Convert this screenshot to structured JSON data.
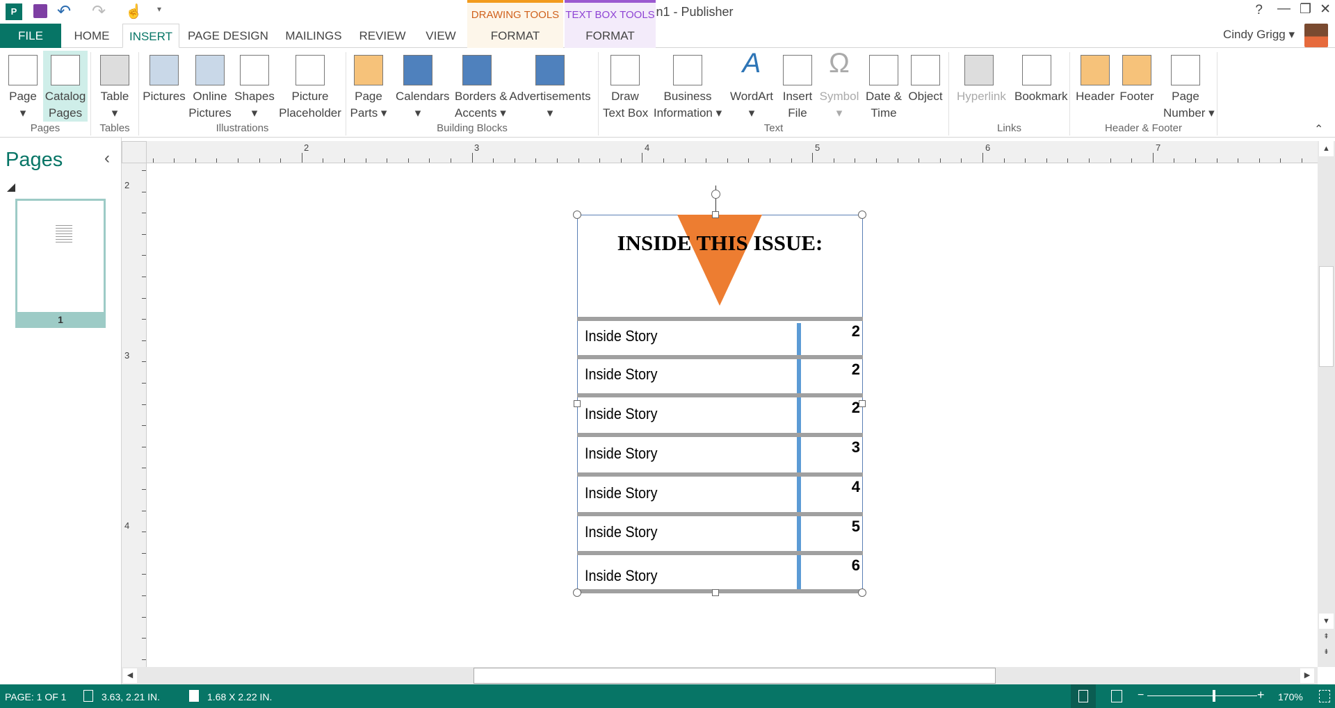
{
  "window": {
    "title": "Publication1 - Publisher",
    "user": "Cindy Grigg",
    "help": "?",
    "minimize": "—",
    "restore": "❐",
    "close": "✕"
  },
  "quick_access": {
    "icons": [
      "publisher-logo-icon",
      "save-icon",
      "undo-icon",
      "redo-icon",
      "touch-mode-icon",
      "customize-icon"
    ]
  },
  "contextual": [
    {
      "header": "DRAWING TOOLS",
      "tab": "FORMAT",
      "color": "#e36c09"
    },
    {
      "header": "TEXT BOX TOOLS",
      "tab": "FORMAT",
      "color": "#8e44d4"
    }
  ],
  "tabs": [
    "FILE",
    "HOME",
    "INSERT",
    "PAGE DESIGN",
    "MAILINGS",
    "REVIEW",
    "VIEW"
  ],
  "active_tab": "INSERT",
  "ribbon": {
    "groups": [
      "Pages",
      "Tables",
      "Illustrations",
      "Building Blocks",
      "Text",
      "Links",
      "Header & Footer"
    ],
    "buttons": [
      {
        "l1": "Page",
        "l2": "▾"
      },
      {
        "l1": "Catalog",
        "l2": "Pages"
      },
      {
        "l1": "Table",
        "l2": "▾"
      },
      {
        "l1": "Pictures",
        "l2": ""
      },
      {
        "l1": "Online",
        "l2": "Pictures"
      },
      {
        "l1": "Shapes",
        "l2": "▾"
      },
      {
        "l1": "Picture",
        "l2": "Placeholder"
      },
      {
        "l1": "Page",
        "l2": "Parts ▾"
      },
      {
        "l1": "Calendars",
        "l2": "▾"
      },
      {
        "l1": "Borders &",
        "l2": "Accents ▾"
      },
      {
        "l1": "Advertisements",
        "l2": "▾"
      },
      {
        "l1": "Draw",
        "l2": "Text Box"
      },
      {
        "l1": "Business",
        "l2": "Information ▾"
      },
      {
        "l1": "WordArt",
        "l2": "▾"
      },
      {
        "l1": "Insert",
        "l2": "File"
      },
      {
        "l1": "Symbol",
        "l2": "▾"
      },
      {
        "l1": "Date &",
        "l2": "Time"
      },
      {
        "l1": "Object",
        "l2": ""
      },
      {
        "l1": "Hyperlink",
        "l2": ""
      },
      {
        "l1": "Bookmark",
        "l2": ""
      },
      {
        "l1": "Header",
        "l2": ""
      },
      {
        "l1": "Footer",
        "l2": ""
      },
      {
        "l1": "Page",
        "l2": "Number ▾"
      }
    ]
  },
  "pages_pane": {
    "title": "Pages",
    "collapse": "‹",
    "page_number": "1"
  },
  "rulers": {
    "horizontal": [
      "2",
      "3",
      "4",
      "5",
      "6",
      "7"
    ],
    "vertical": [
      "2",
      "3",
      "4"
    ]
  },
  "document": {
    "heading": "INSIDE THIS ISSUE:",
    "accent": "#ed7d31",
    "divider": "#5b9bd5",
    "rows": [
      {
        "story": "Inside Story",
        "page": "2"
      },
      {
        "story": "Inside Story",
        "page": "2"
      },
      {
        "story": "Inside Story",
        "page": "2"
      },
      {
        "story": "Inside Story",
        "page": "3"
      },
      {
        "story": "Inside Story",
        "page": "4"
      },
      {
        "story": "Inside Story",
        "page": "5"
      },
      {
        "story": "Inside Story",
        "page": "6"
      }
    ]
  },
  "status": {
    "page": "PAGE: 1 OF 1",
    "position": "3.63, 2.21 IN.",
    "size": "1.68 X 2.22 IN.",
    "zoom": "170%",
    "zoom_percent": 170,
    "bar": "#077566"
  }
}
